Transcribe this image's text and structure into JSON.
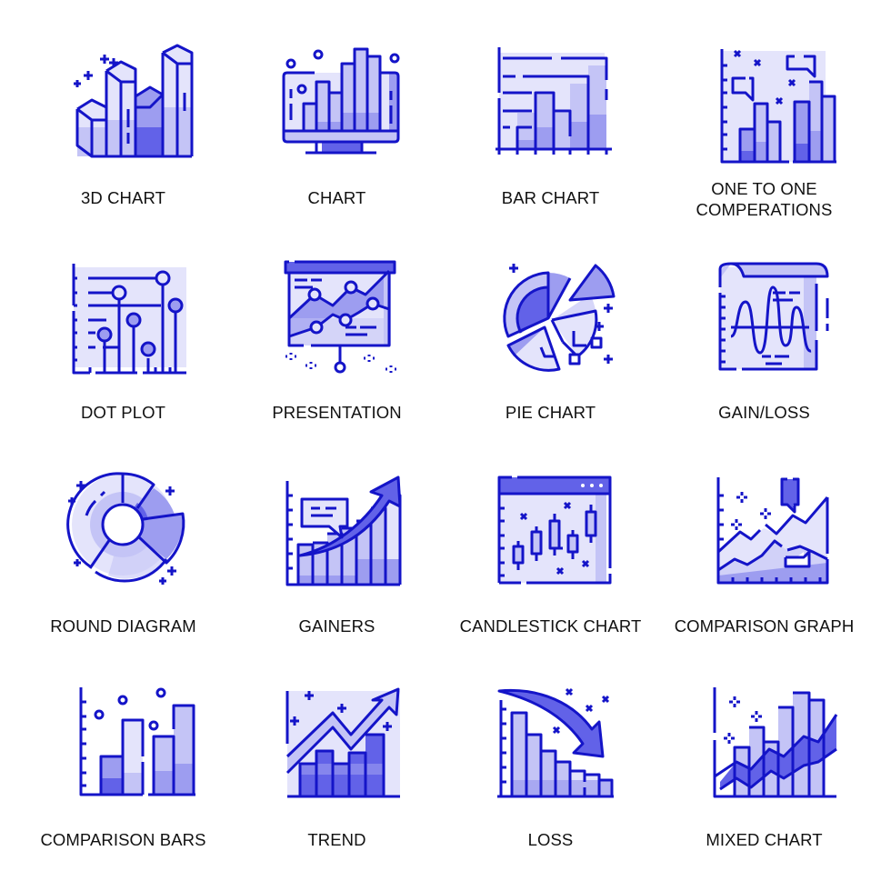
{
  "icon_set": {
    "stroke_color": "#1414c8",
    "fill_colors": [
      "#e4e4fb",
      "#c4c4f6",
      "#9d9df0",
      "#6262e8"
    ],
    "label_color": "#111111"
  },
  "icons": [
    {
      "label": "3D CHART",
      "icon": "3d-bar-chart-icon"
    },
    {
      "label": "CHART",
      "icon": "monitor-bar-chart-icon"
    },
    {
      "label": "BAR CHART",
      "icon": "bar-chart-icon"
    },
    {
      "label": "ONE TO ONE COMPERATIONS",
      "label_lines": [
        "ONE TO ONE",
        "COMPERATIONS"
      ],
      "icon": "grouped-bar-chart-icon"
    },
    {
      "label": "DOT PLOT",
      "icon": "dot-plot-icon"
    },
    {
      "label": "PRESENTATION",
      "icon": "presentation-board-icon"
    },
    {
      "label": "PIE CHART",
      "icon": "pie-chart-icon"
    },
    {
      "label": "GAIN/LOSS",
      "icon": "wave-document-icon"
    },
    {
      "label": "ROUND DIAGRAM",
      "icon": "donut-chart-icon"
    },
    {
      "label": "GAINERS",
      "icon": "rising-bars-arrow-icon"
    },
    {
      "label": "CANDLESTICK CHART",
      "icon": "candlestick-chart-icon"
    },
    {
      "label": "COMPARISON GRAPH",
      "icon": "line-comparison-icon"
    },
    {
      "label": "COMPARISON BARS",
      "icon": "comparison-bars-icon"
    },
    {
      "label": "TREND",
      "icon": "trend-arrow-icon"
    },
    {
      "label": "LOSS",
      "icon": "falling-bars-arrow-icon"
    },
    {
      "label": "MIXED CHART",
      "icon": "mixed-chart-icon"
    }
  ]
}
